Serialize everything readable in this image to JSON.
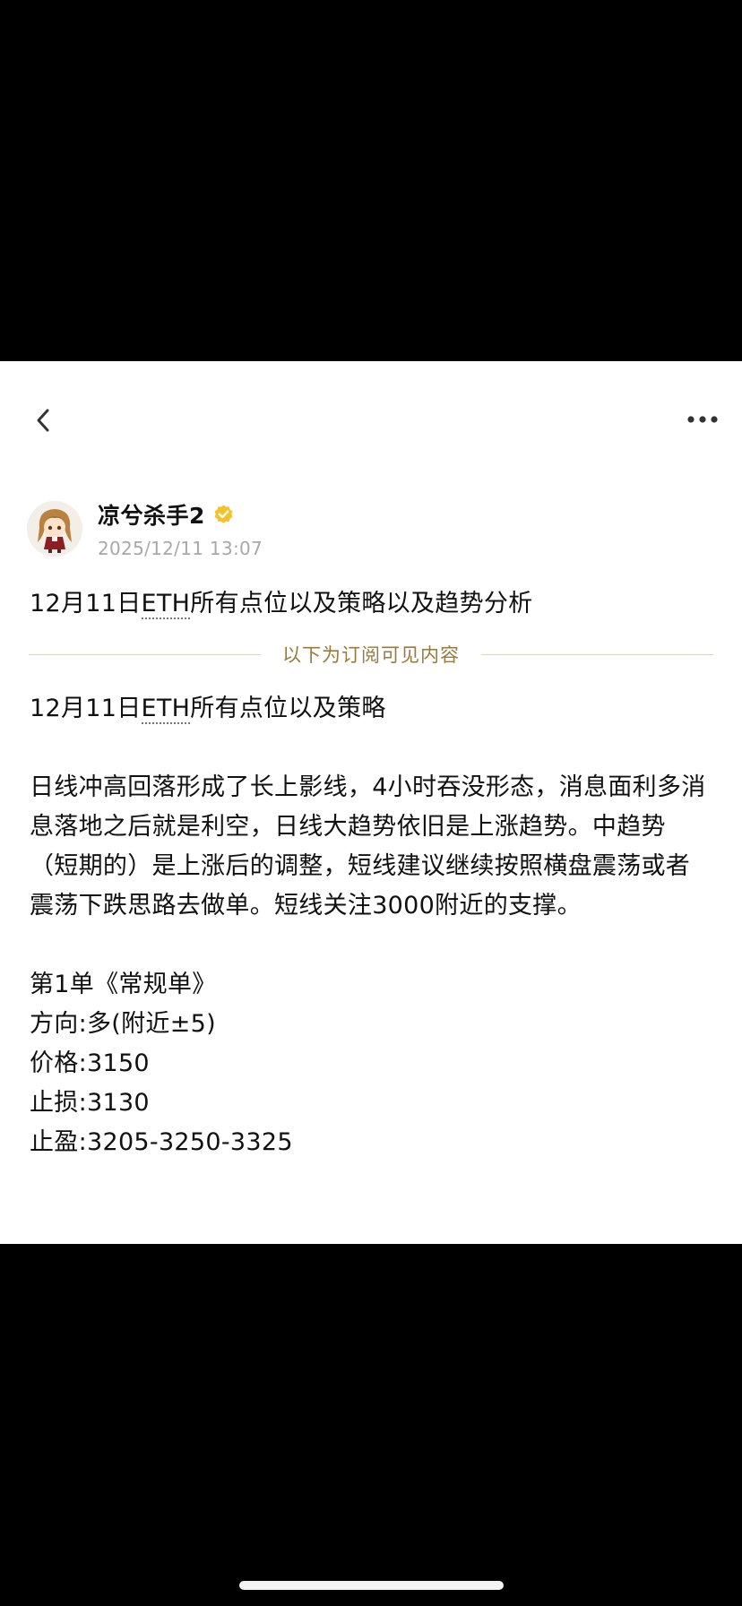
{
  "header": {
    "back_icon": "chevron-left-icon",
    "more_icon": "more-horizontal-icon"
  },
  "author": {
    "name": "凉兮杀手2",
    "date": "2025/12/11 13:07",
    "verified_color": "#f4c22a",
    "avatar_icon": "anime-avatar"
  },
  "post": {
    "title_prefix": "12月11日",
    "title_eth": "ETH",
    "title_suffix": "所有点位以及策略以及趋势分析",
    "divider_label": "以下为订阅可见内容",
    "subtitle_prefix": "12月11日",
    "subtitle_eth": "ETH",
    "subtitle_suffix": "所有点位以及策略",
    "analysis": "日线冲高回落形成了长上影线，4小时吞没形态，消息面利多消息落地之后就是利空，日线大趋势依旧是上涨趋势。中趋势（短期的）是上涨后的调整，短线建议继续按照横盘震荡或者震荡下跌思路去做单。短线关注3000附近的支撑。",
    "order_title": "第1单《常规单》",
    "order_direction": "方向:多(附近±5)",
    "order_price": "价格:3150",
    "order_stop_loss": "止损:3130",
    "order_take_profit": "止盈:3205-3250-3325"
  },
  "colors": {
    "accent_gold": "#9a7a3c",
    "text": "#111111",
    "muted": "#a8a8a8"
  }
}
